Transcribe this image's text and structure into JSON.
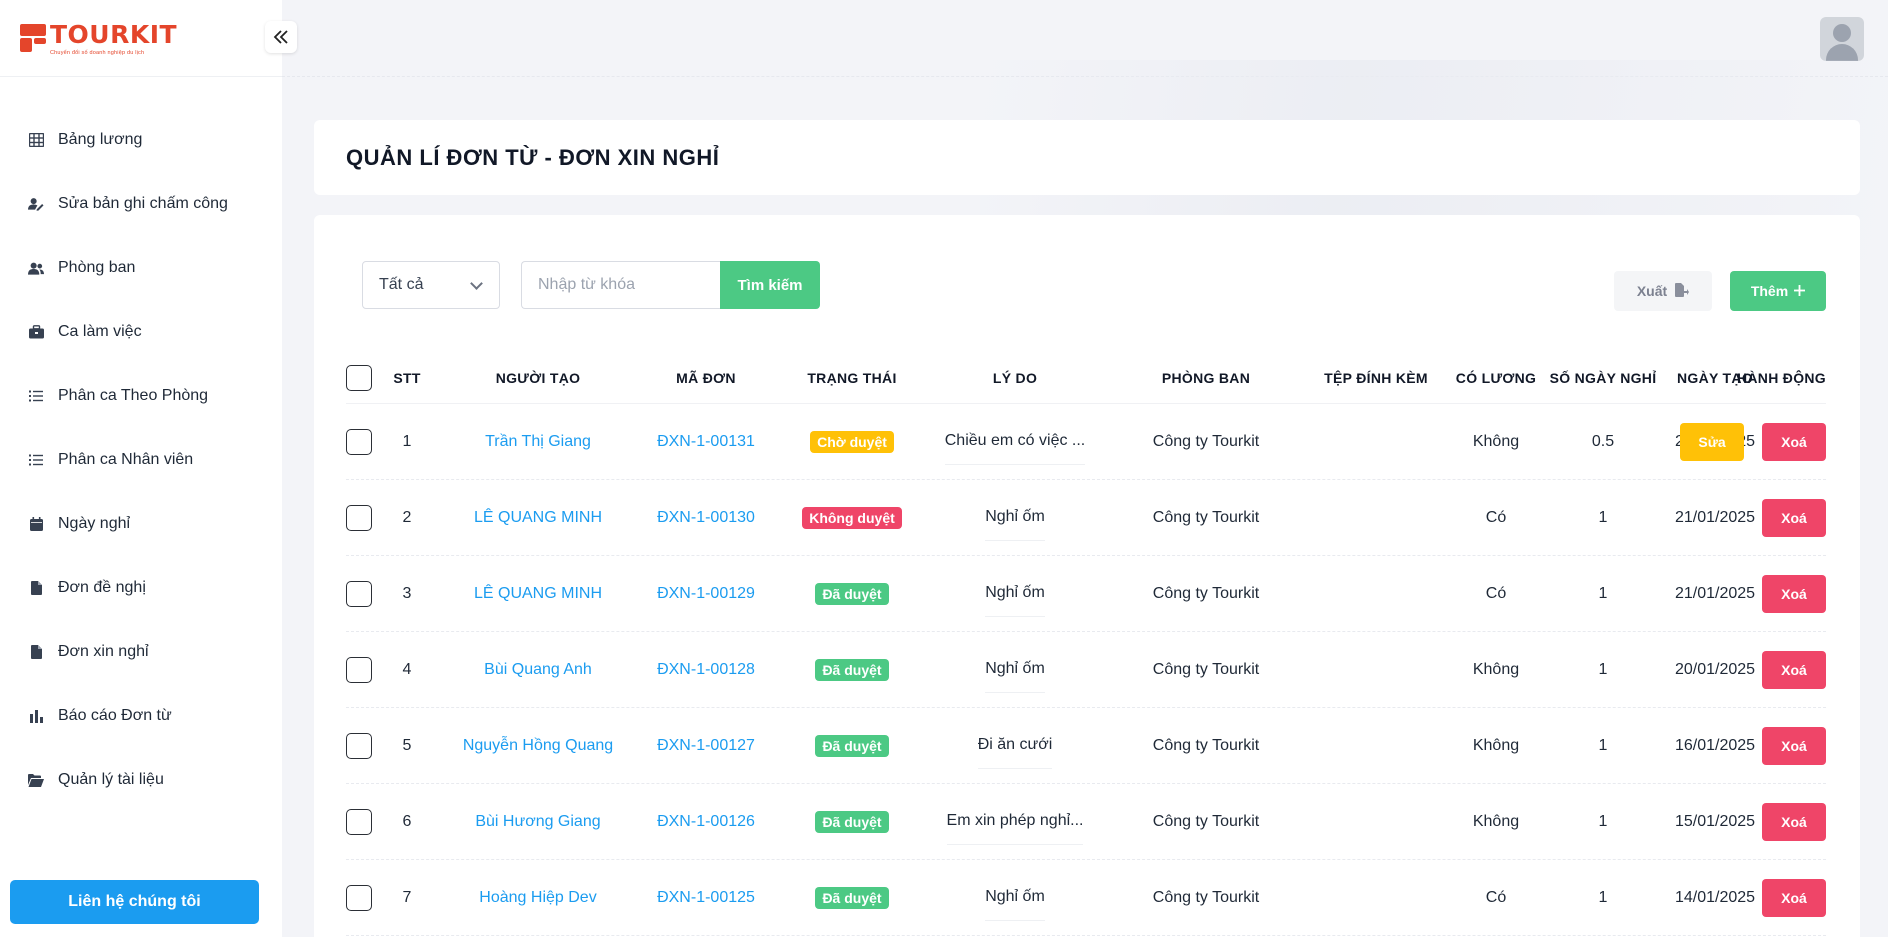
{
  "brand": {
    "name": "TOURKIT",
    "tagline": "Chuyển đổi số doanh nghiệp du lịch"
  },
  "sidebar": {
    "items": [
      {
        "label": "Bảng lương",
        "icon": "table-icon"
      },
      {
        "label": "Sửa bản ghi chấm công",
        "icon": "user-edit-icon"
      },
      {
        "label": "Phòng ban",
        "icon": "users-icon"
      },
      {
        "label": "Ca làm việc",
        "icon": "briefcase-icon"
      },
      {
        "label": "Phân ca Theo Phòng",
        "icon": "list-icon"
      },
      {
        "label": "Phân ca Nhân viên",
        "icon": "list-icon"
      },
      {
        "label": "Ngày nghỉ",
        "icon": "calendar-icon"
      },
      {
        "label": "Đơn đề nghị",
        "icon": "file-icon"
      },
      {
        "label": "Đơn xin nghỉ",
        "icon": "file-icon"
      },
      {
        "label": "Báo cáo Đơn từ",
        "icon": "bar-chart-icon"
      },
      {
        "label": "Quản lý tài liệu",
        "icon": "folder-open-icon"
      }
    ],
    "contact_label": "Liên hệ chúng tôi"
  },
  "page": {
    "title": "QUẢN LÍ ĐƠN TỪ - ĐƠN XIN NGHỈ"
  },
  "filters": {
    "status_select": "Tất cả",
    "search_placeholder": "Nhập từ khóa",
    "search_button": "Tìm kiếm",
    "export_button": "Xuất",
    "add_button": "Thêm"
  },
  "table": {
    "headers": {
      "stt": "STT",
      "creator": "NGƯỜI TẠO",
      "code": "MÃ ĐƠN",
      "status": "TRẠNG THÁI",
      "reason": "LÝ DO",
      "dept": "PHÒNG BAN",
      "file": "TỆP ĐÍNH KÈM",
      "salary": "CÓ LƯƠNG",
      "days": "SỐ NGÀY NGHỈ",
      "date": "NGÀY TẠO",
      "actions": "HÀNH ĐỘNG"
    },
    "edit_label": "Sửa",
    "delete_label": "Xoá",
    "rows": [
      {
        "stt": "1",
        "creator": "Trần Thị Giang",
        "code": "ĐXN-1-00131",
        "status": "Chờ duyệt",
        "status_kind": "wait",
        "reason": "Chiều em có việc ...",
        "dept": "Công ty Tourkit",
        "file": "",
        "salary": "Không",
        "days": "0.5",
        "date": "21/01/2025",
        "editable": true
      },
      {
        "stt": "2",
        "creator": "LÊ QUANG MINH",
        "code": "ĐXN-1-00130",
        "status": "Không duyệt",
        "status_kind": "rej",
        "reason": "Nghỉ ốm",
        "dept": "Công ty Tourkit",
        "file": "",
        "salary": "Có",
        "days": "1",
        "date": "21/01/2025",
        "editable": false
      },
      {
        "stt": "3",
        "creator": "LÊ QUANG MINH",
        "code": "ĐXN-1-00129",
        "status": "Đã duyệt",
        "status_kind": "ok",
        "reason": "Nghỉ ốm",
        "dept": "Công ty Tourkit",
        "file": "",
        "salary": "Có",
        "days": "1",
        "date": "21/01/2025",
        "editable": false
      },
      {
        "stt": "4",
        "creator": "Bùi Quang Anh",
        "code": "ĐXN-1-00128",
        "status": "Đã duyệt",
        "status_kind": "ok",
        "reason": "Nghỉ ốm",
        "dept": "Công ty Tourkit",
        "file": "",
        "salary": "Không",
        "days": "1",
        "date": "20/01/2025",
        "editable": false
      },
      {
        "stt": "5",
        "creator": "Nguyễn Hồng Quang",
        "code": "ĐXN-1-00127",
        "status": "Đã duyệt",
        "status_kind": "ok",
        "reason": "Đi ăn cưới",
        "dept": "Công ty Tourkit",
        "file": "",
        "salary": "Không",
        "days": "1",
        "date": "16/01/2025",
        "editable": false
      },
      {
        "stt": "6",
        "creator": "Bùi Hương Giang",
        "code": "ĐXN-1-00126",
        "status": "Đã duyệt",
        "status_kind": "ok",
        "reason": "Em xin phép nghỉ...",
        "dept": "Công ty Tourkit",
        "file": "",
        "salary": "Không",
        "days": "1",
        "date": "15/01/2025",
        "editable": false
      },
      {
        "stt": "7",
        "creator": "Hoàng Hiệp Dev",
        "code": "ĐXN-1-00125",
        "status": "Đã duyệt",
        "status_kind": "ok",
        "reason": "Nghỉ ốm",
        "dept": "Công ty Tourkit",
        "file": "",
        "salary": "Có",
        "days": "1",
        "date": "14/01/2025",
        "editable": false
      }
    ]
  }
}
